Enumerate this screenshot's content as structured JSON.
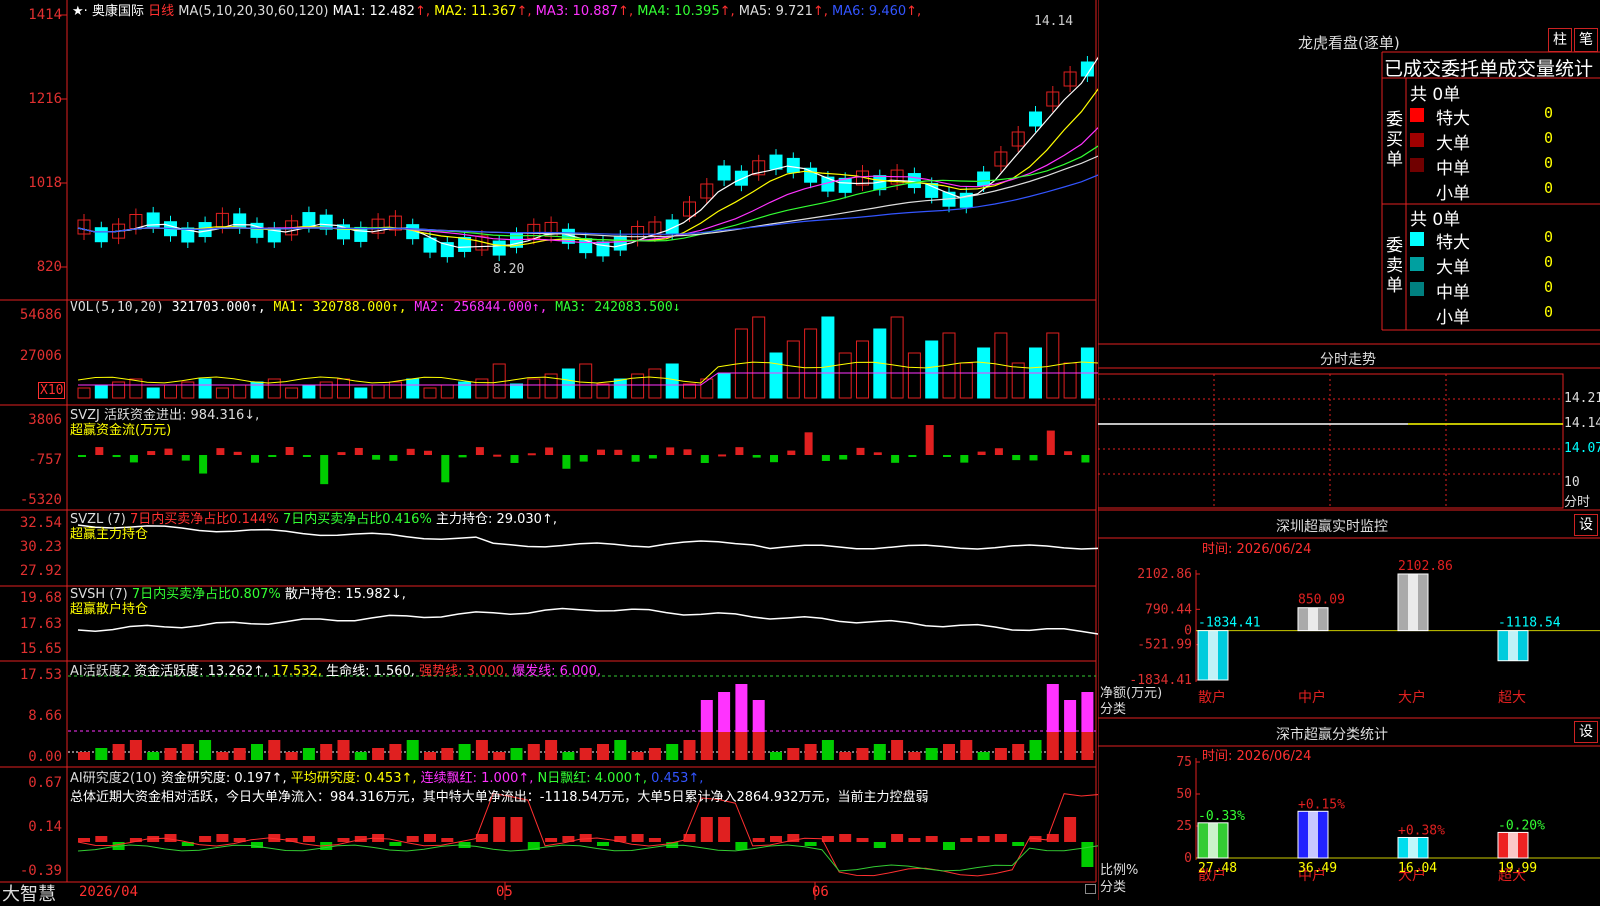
{
  "stock": {
    "name": "奥康国际",
    "period": "日线",
    "ma_header": "MA(5,10,20,30,60,120)",
    "ma": [
      {
        "label": "MA1:",
        "value": "12.482",
        "arrow": "↑",
        "color": "#ffffff"
      },
      {
        "label": "MA2:",
        "value": "11.367",
        "arrow": "↑",
        "color": "#ffff00"
      },
      {
        "label": "MA3:",
        "value": "10.887",
        "arrow": "↑",
        "color": "#ff33ff"
      },
      {
        "label": "MA4:",
        "value": "10.395",
        "arrow": "↑",
        "color": "#33ff33"
      },
      {
        "label": "MA5:",
        "value": "9.721",
        "arrow": "↑",
        "color": "#dddddd"
      },
      {
        "label": "MA6:",
        "value": "9.460",
        "arrow": "↑",
        "color": "#3355ff"
      }
    ],
    "high_label": "14.14",
    "low_label": "8.20",
    "price_ticks": [
      "1414",
      "1216",
      "1018",
      "820"
    ]
  },
  "vol": {
    "header": "VOL(5,10,20)",
    "value": "321703.000↑,",
    "ma1": "MA1: 320788.000↑,",
    "ma2": "MA2: 256844.000↑,",
    "ma3": "MA3: 242083.500↓",
    "ticks": [
      "54686",
      "27006"
    ],
    "unit": "X10"
  },
  "svzj": {
    "header": "SVZJ  活跃资金进出: 984.316↓,",
    "sub": "超赢资金流(万元)",
    "ticks": [
      "3806",
      "-757",
      "-5320"
    ]
  },
  "svzl": {
    "header_a": "SVZL (7)",
    "header_b": "7日内买卖净占比0.144%",
    "header_c": "7日内买卖净占比0.416%",
    "header_d": "主力持仓: 29.030↑,",
    "sub": "超赢主力持仓",
    "ticks": [
      "32.54",
      "30.23",
      "27.92"
    ]
  },
  "svsh": {
    "header_a": "SVSH (7)",
    "header_b": "7日内买卖净占比0.807%",
    "header_c": "散户持仓: 15.982↓,",
    "sub": "超赢散户持仓",
    "ticks": [
      "19.68",
      "17.63",
      "15.65"
    ]
  },
  "ai_active": {
    "header_a": "AI活跃度2",
    "header_b": "资金活跃度: 13.262↑,",
    "header_c": "17.532,",
    "header_d": "生命线: 1.560,",
    "header_e": "强势线: 3.000,",
    "header_f": "爆发线: 6.000,",
    "ticks": [
      "17.53",
      "8.66",
      "0.00"
    ]
  },
  "ai_research": {
    "header_a": "AI研究度2(10)",
    "header_b": "资金研究度: 0.197↑,",
    "header_c": "平均研究度: 0.453↑,",
    "header_d": "连续飘红: 1.000↑,",
    "header_e": "N日飘红: 4.000↑,",
    "header_f": "0.453↑,",
    "summary": "总体近期大资金相对活跃，今日大单净流入：984.316万元，其中特大单净流出：-1118.54万元，大单5日累计净入2864.932万元，当前主力控盘弱",
    "ticks": [
      "0.67",
      "0.14",
      "-0.39"
    ]
  },
  "bottom": {
    "brand": "大智慧",
    "date_axis": [
      "2026/04",
      "05",
      "06"
    ]
  },
  "longhu": {
    "title": "龙虎看盘(逐单)",
    "btn_bar": "柱",
    "btn_tick": "笔",
    "table_title": "已成交委托单成交量统计",
    "buy": {
      "side": "委买单",
      "total": "共 0单",
      "rows": [
        {
          "label": "特大",
          "value": "0",
          "color": "#ff0000"
        },
        {
          "label": "大单",
          "value": "0",
          "color": "#a00000"
        },
        {
          "label": "中单",
          "value": "0",
          "color": "#700000"
        },
        {
          "label": "小单",
          "value": "0",
          "color": ""
        }
      ]
    },
    "sell": {
      "side": "委卖单",
      "total": "共 0单",
      "rows": [
        {
          "label": "特大",
          "value": "0",
          "color": "#00ffff"
        },
        {
          "label": "大单",
          "value": "0",
          "color": "#00a0a0"
        },
        {
          "label": "中单",
          "value": "0",
          "color": "#008080"
        },
        {
          "label": "小单",
          "value": "0",
          "color": ""
        }
      ]
    }
  },
  "intraday": {
    "title": "分时走势",
    "ticks": [
      "14.21",
      "14.14",
      "14.07"
    ],
    "footer_a": "10",
    "footer_b": "分时"
  },
  "sz_monitor": {
    "title": "深圳超赢实时监控",
    "settings": "设",
    "time": "时间: 2026/06/24",
    "ticks": [
      "2102.86",
      "790.44",
      "0",
      "-521.99",
      "-1834.41"
    ],
    "ylabel": "净额(万元)",
    "xlabel": "分类",
    "bars": [
      {
        "cat": "散户",
        "value": -1834.41,
        "label": "-1834.41"
      },
      {
        "cat": "中户",
        "value": 850.09,
        "label": "850.09"
      },
      {
        "cat": "大户",
        "value": 2102.86,
        "label": "2102.86"
      },
      {
        "cat": "超大",
        "value": -1118.54,
        "label": "-1118.54"
      }
    ]
  },
  "sz_class": {
    "title": "深市超赢分类统计",
    "settings": "设",
    "time": "时间: 2026/06/24",
    "ticks": [
      "75",
      "50",
      "25",
      "0"
    ],
    "ylabel": "比例%",
    "xlabel": "分类",
    "bars": [
      {
        "cat": "散户",
        "value": 27.48,
        "label": "27.48",
        "chg": "-0.33%"
      },
      {
        "cat": "中户",
        "value": 36.49,
        "label": "36.49",
        "chg": "+0.15%"
      },
      {
        "cat": "大户",
        "value": 16.04,
        "label": "16.04",
        "chg": "+0.38%"
      },
      {
        "cat": "超大",
        "value": 19.99,
        "label": "19.99",
        "chg": "-0.20%"
      }
    ]
  },
  "chart_data": {
    "type": "bar",
    "title": "深圳超赢实时监控",
    "categories": [
      "散户",
      "中户",
      "大户",
      "超大"
    ],
    "series": [
      {
        "name": "净额(万元)",
        "values": [
          -1834.41,
          850.09,
          2102.86,
          -1118.54
        ]
      },
      {
        "name": "比例%",
        "values": [
          27.48,
          36.49,
          16.04,
          19.99
        ]
      }
    ],
    "ylim": [
      -1834.41,
      2102.86
    ]
  }
}
